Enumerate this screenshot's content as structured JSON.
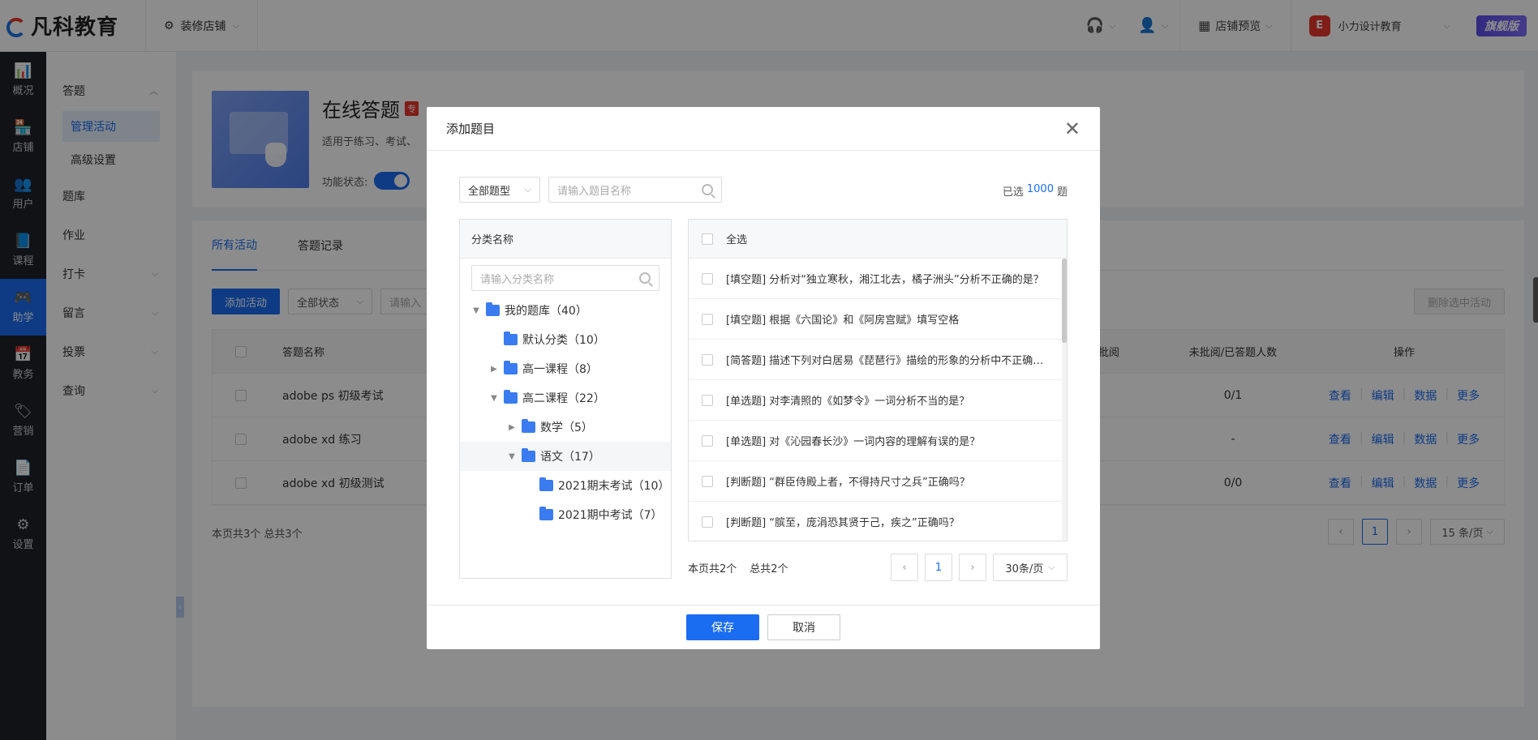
{
  "topbar": {
    "logo_text": "凡科教育",
    "decorate": "装修店铺",
    "preview": "店铺预览",
    "account": "小力设计教育",
    "vip_badge": "旗舰版"
  },
  "leftnav": [
    "概况",
    "店铺",
    "用户",
    "课程",
    "助学",
    "教务",
    "营销",
    "订单",
    "设置"
  ],
  "submenu": {
    "group1": "答题",
    "group1_children": [
      "管理活动",
      "高级设置"
    ],
    "items": [
      "题库",
      "作业",
      "打卡",
      "留言",
      "投票",
      "查询"
    ]
  },
  "activity": {
    "title": "在线答题",
    "tag": "专",
    "desc": "适用于练习、考试、",
    "status_label": "功能状态:"
  },
  "list": {
    "tabs": [
      "所有活动",
      "答题记录"
    ],
    "add_button": "添加活动",
    "status_select": "全部状态",
    "search_placeholder": "请输入",
    "delete_button": "删除选中活动",
    "headers": {
      "name": "答题名称",
      "review": "批阅",
      "unreviewed": "未批阅/已答题人数",
      "ops": "操作"
    },
    "rows": [
      {
        "name": "adobe ps 初级考试",
        "unreviewed": "0/1"
      },
      {
        "name": "adobe xd 练习",
        "unreviewed": "-"
      },
      {
        "name": "adobe xd 初级测试",
        "unreviewed": "0/0"
      }
    ],
    "op_labels": [
      "查看",
      "编辑",
      "数据",
      "更多"
    ],
    "footer": "本页共3个 总共3个",
    "page": "1",
    "page_size": "15 条/页"
  },
  "modal": {
    "title": "添加题目",
    "type_select": "全部题型",
    "search_placeholder": "请输入题目名称",
    "selected_prefix": "已选",
    "selected_count": "1000",
    "selected_suffix": "题",
    "tree_header": "分类名称",
    "tree_search_placeholder": "请输入分类名称",
    "tree": [
      {
        "label": "我的题库（40）",
        "level": 0,
        "toggle": "down"
      },
      {
        "label": "默认分类（10）",
        "level": 1,
        "toggle": "none"
      },
      {
        "label": "高一课程（8）",
        "level": 1,
        "toggle": "right"
      },
      {
        "label": "高二课程（22）",
        "level": 1,
        "toggle": "down"
      },
      {
        "label": "数学（5）",
        "level": 2,
        "toggle": "right"
      },
      {
        "label": "语文（17）",
        "level": 2,
        "toggle": "down"
      },
      {
        "label": "2021期末考试（10）",
        "level": 3,
        "toggle": "none"
      },
      {
        "label": "2021期中考试（7）",
        "level": 3,
        "toggle": "none"
      }
    ],
    "select_all": "全选",
    "questions": [
      "[填空题] 分析对“独立寒秋，湘江北去，橘子洲头”分析不正确的是？",
      "[填空题] 根据《六国论》和《阿房宫赋》填写空格",
      "[简答题] 描述下列对白居易《琵琶行》描绘的形象的分析中不正确的是？",
      "[单选题] 对李清照的《如梦令》一词分析不当的是？",
      "[单选题] 对《沁园春长沙》一词内容的理解有误的是？",
      "[判断题] “群臣侍殿上者，不得持尺寸之兵”正确吗？",
      "[判断题] “膑至，庞涓恐其贤于己，疾之”正确吗？"
    ],
    "q_footer_page": "本页共2个",
    "q_footer_total": "总共2个",
    "q_page": "1",
    "q_page_size": "30条/页",
    "save": "保存",
    "cancel": "取消"
  }
}
